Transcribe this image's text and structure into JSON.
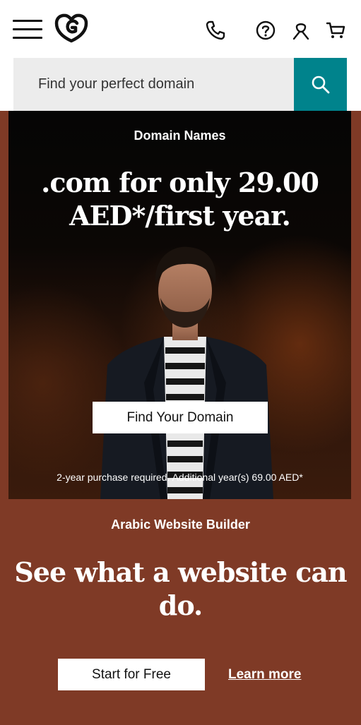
{
  "header": {
    "menu_icon": "hamburger-icon",
    "logo_icon": "godaddy-logo",
    "phone_icon": "phone-icon",
    "help_icon": "help-icon",
    "account_icon": "user-icon",
    "cart_icon": "cart-icon"
  },
  "search": {
    "placeholder": "Find your perfect domain",
    "button_icon": "search-icon",
    "accent_color": "#00838c"
  },
  "hero": {
    "eyebrow": "Domain Names",
    "title": ".com for only 29.00 AED*/first year.",
    "cta_label": "Find Your Domain",
    "disclaimer": "2-year purchase required. Additional year(s) 69.00 AED*"
  },
  "promo": {
    "eyebrow": "Arabic Website Builder",
    "title": "See what a website can do.",
    "cta_label": "Start for Free",
    "link_label": "Learn more",
    "background_color": "#7f3a26"
  }
}
